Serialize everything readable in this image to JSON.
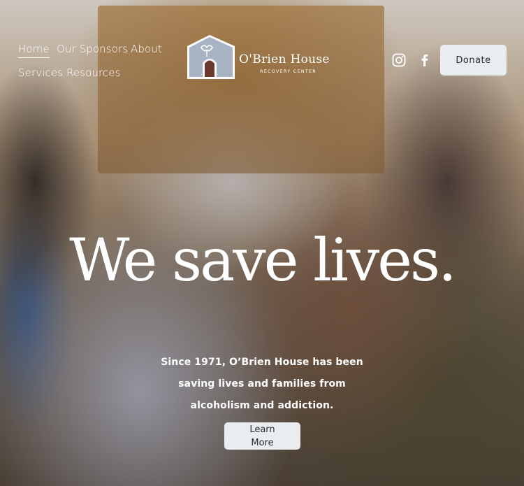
{
  "nav": {
    "items": [
      {
        "label": "Home",
        "active": true
      },
      {
        "label": "Our Sponsors"
      },
      {
        "label": "About"
      },
      {
        "label": "Services"
      },
      {
        "label": "Resources"
      }
    ]
  },
  "logo": {
    "name": "O'Brien House",
    "subtitle": "RECOVERY CENTER"
  },
  "social": {
    "icons": [
      "instagram-icon",
      "facebook-icon"
    ]
  },
  "header": {
    "donate_label": "Donate"
  },
  "hero": {
    "headline": "We save lives.",
    "body": "Since 1971, O’Brien House has been saving lives and families from alcoholism and addiction.",
    "cta_line1": "Learn",
    "cta_line2": "More"
  },
  "colors": {
    "button_bg": "#e9edf0",
    "logo_wall": "#a8b3c4",
    "logo_door": "#6b3a2f",
    "text": "#ffffff"
  }
}
